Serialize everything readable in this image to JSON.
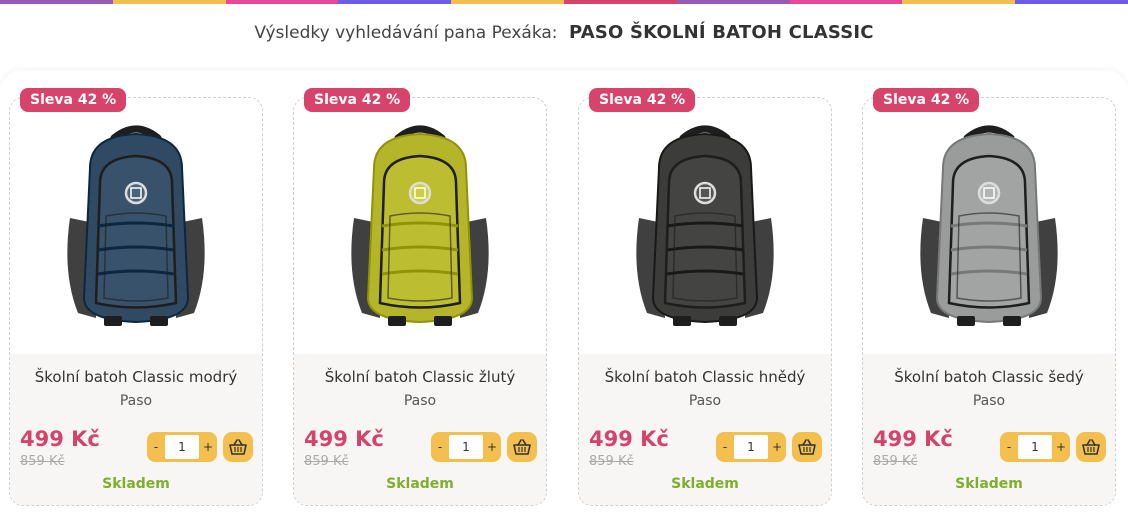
{
  "header": {
    "label": "Výsledky vyhledávání pana Pexáka:",
    "query": "PASO ŠKOLNÍ BATOH CLASSIC"
  },
  "colors": {
    "accent_badge": "#d8436b",
    "price": "#d3436a",
    "stock": "#7fae2c",
    "button": "#f3c04f",
    "topbar": [
      "#9b59b6",
      "#f3c04f",
      "#e6499a",
      "#6c5ce7",
      "#f3c04f",
      "#d8436b",
      "#9b59b6",
      "#e6499a",
      "#f3c04f",
      "#6c5ce7"
    ]
  },
  "products": [
    {
      "badge": "Sleva 42 %",
      "name": "Školní batoh Classic modrý",
      "brand": "Paso",
      "price": "499 Kč",
      "old_price": "859 Kč",
      "qty": "1",
      "minus": "-",
      "plus": "+",
      "stock": "Skladem",
      "color": "#2f4a62"
    },
    {
      "badge": "Sleva 42 %",
      "name": "Školní batoh Classic žlutý",
      "brand": "Paso",
      "price": "499 Kč",
      "old_price": "859 Kč",
      "qty": "1",
      "minus": "-",
      "plus": "+",
      "stock": "Skladem",
      "color": "#b5b52a"
    },
    {
      "badge": "Sleva 42 %",
      "name": "Školní batoh Classic hnědý",
      "brand": "Paso",
      "price": "499 Kč",
      "old_price": "859 Kč",
      "qty": "1",
      "minus": "-",
      "plus": "+",
      "stock": "Skladem",
      "color": "#3c3c3a"
    },
    {
      "badge": "Sleva 42 %",
      "name": "Školní batoh Classic šedý",
      "brand": "Paso",
      "price": "499 Kč",
      "old_price": "859 Kč",
      "qty": "1",
      "minus": "-",
      "plus": "+",
      "stock": "Skladem",
      "color": "#9a9c9c"
    }
  ]
}
